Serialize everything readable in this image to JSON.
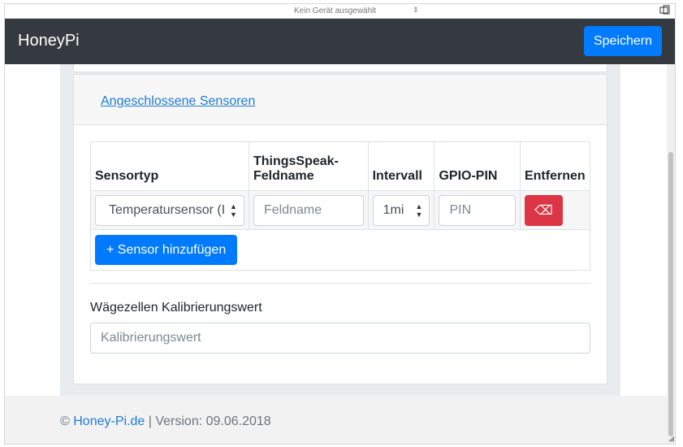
{
  "device_bar": {
    "device_label": "Kein Gerät ausgewählt",
    "device_arrow": "⇕",
    "rotate_icon": "rotate-icon"
  },
  "navbar": {
    "brand": "HoneyPi",
    "save_label": "Speichern"
  },
  "sensors_card": {
    "header_link": "Angeschlossene Sensoren",
    "table": {
      "headers": [
        "Sensortyp",
        "ThingsSpeak-Feldname",
        "Intervall",
        "GPIO-PIN",
        "Entfernen"
      ],
      "rows": [
        {
          "sensor_type": "Temperatursensor (I",
          "field_placeholder": "Feldname",
          "interval": "1mi",
          "pin_placeholder": "PIN",
          "remove_icon": "⌫"
        }
      ]
    },
    "add_sensor_label": "+ Sensor hinzufügen"
  },
  "calibration": {
    "label": "Wägezellen Kalibrierungswert",
    "placeholder": "Kalibrierungswert"
  },
  "footer": {
    "copyright": "©",
    "link_text": "Honey-Pi.de",
    "version_text": "| Version: 09.06.2018"
  },
  "colors": {
    "navbar": "#343a40",
    "primary": "#007bff",
    "danger": "#dc3545",
    "link": "#1e7bd4"
  }
}
